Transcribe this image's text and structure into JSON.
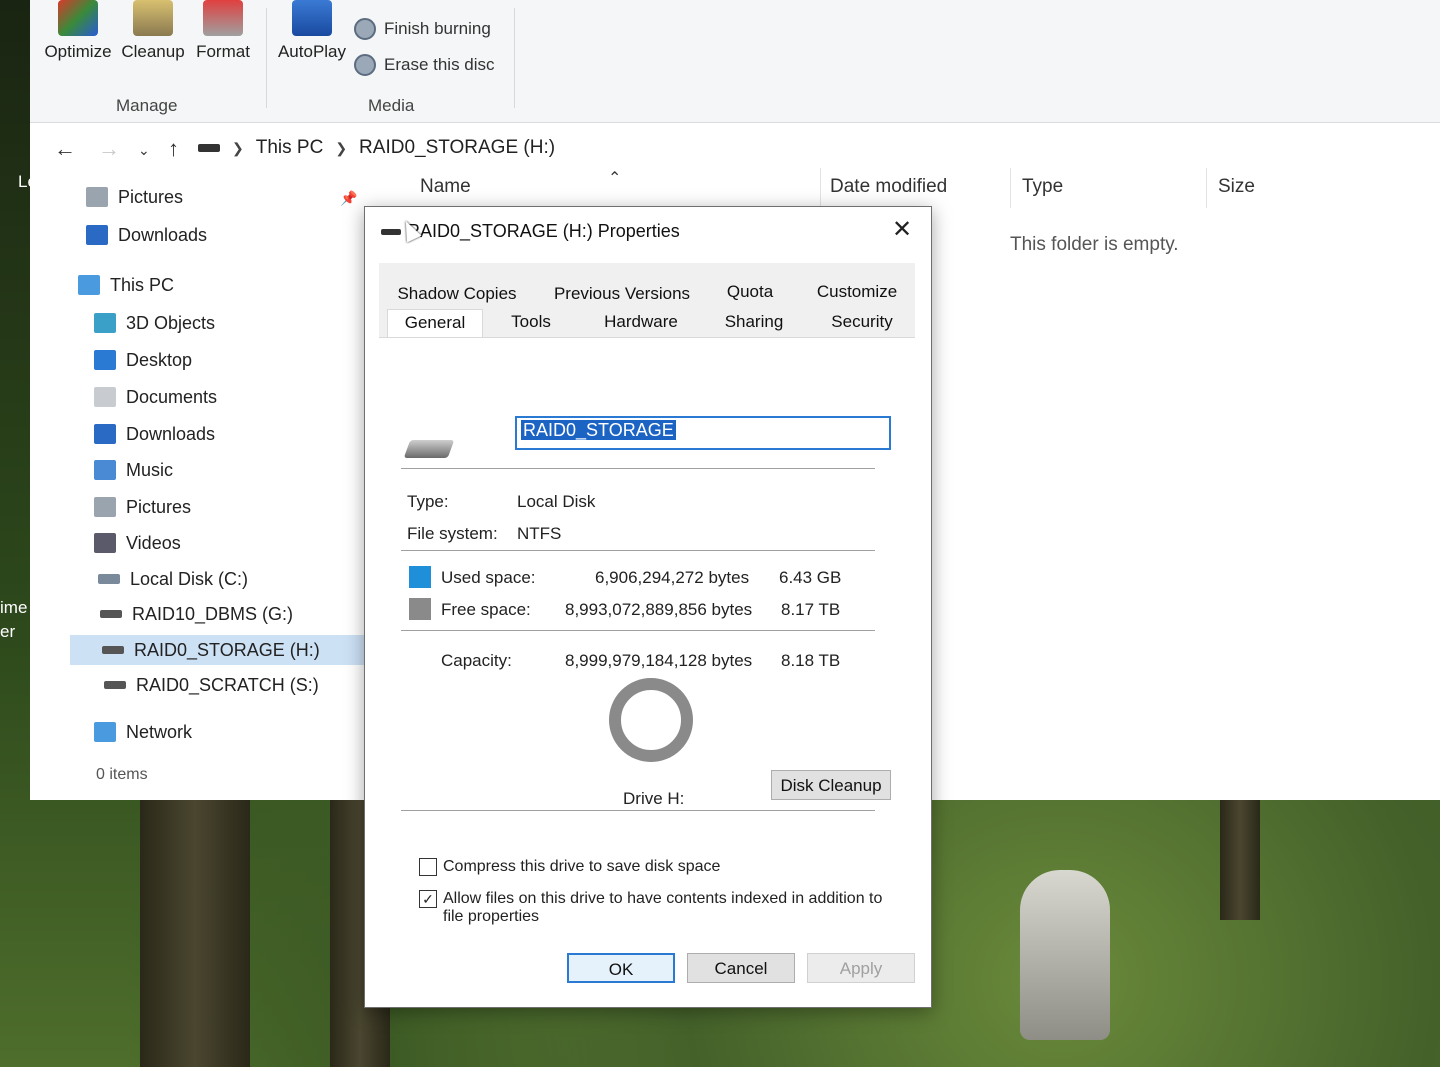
{
  "ribbon": {
    "buttons": [
      "Optimize",
      "Cleanup",
      "Format",
      "AutoPlay"
    ],
    "media_items": [
      "Finish burning",
      "Erase this disc"
    ],
    "groups": [
      "Manage",
      "Media"
    ]
  },
  "address": {
    "crumbs": [
      "This PC",
      "RAID0_STORAGE (H:)"
    ]
  },
  "nav": {
    "quick": [
      "Pictures",
      "Downloads"
    ],
    "this_pc": "This PC",
    "items": [
      "3D Objects",
      "Desktop",
      "Documents",
      "Downloads",
      "Music",
      "Pictures",
      "Videos",
      "Local Disk (C:)",
      "RAID10_DBMS (G:)",
      "RAID0_STORAGE (H:)",
      "RAID0_SCRATCH (S:)"
    ],
    "network": "Network",
    "status": "0 items"
  },
  "columns": [
    "Name",
    "Date modified",
    "Type",
    "Size"
  ],
  "empty_message": "This folder is empty.",
  "desktop_fragments": [
    "Le",
    "ime",
    "er"
  ],
  "dialog": {
    "title": "RAID0_STORAGE (H:) Properties",
    "tabs_row1": [
      "Shadow Copies",
      "Previous Versions",
      "Quota",
      "Customize"
    ],
    "tabs_row2": [
      "General",
      "Tools",
      "Hardware",
      "Sharing",
      "Security"
    ],
    "active_tab": "General",
    "volume_name": "RAID0_STORAGE",
    "type_label": "Type:",
    "type_value": "Local Disk",
    "fs_label": "File system:",
    "fs_value": "NTFS",
    "used_label": "Used space:",
    "used_bytes": "6,906,294,272 bytes",
    "used_human": "6.43 GB",
    "free_label": "Free space:",
    "free_bytes": "8,993,072,889,856 bytes",
    "free_human": "8.17 TB",
    "capacity_label": "Capacity:",
    "capacity_bytes": "8,999,979,184,128 bytes",
    "capacity_human": "8.18 TB",
    "drive_label": "Drive H:",
    "disk_cleanup": "Disk Cleanup",
    "compress_label": "Compress this drive to save disk space",
    "index_label": "Allow files on this drive to have contents indexed in addition to file properties",
    "ok": "OK",
    "cancel": "Cancel",
    "apply": "Apply",
    "colors": {
      "used": "#1e8fd8",
      "free": "#8a8a8a",
      "accent": "#2a7ad4"
    }
  }
}
